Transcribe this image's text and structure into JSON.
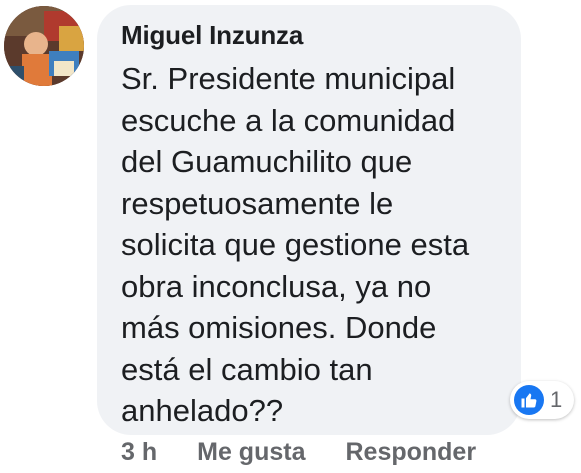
{
  "comment": {
    "author": "Miguel Inzunza",
    "text_lines": [
      "Sr. Presidente municipal",
      "escuche a la comunidad",
      "del Guamuchilito que",
      "respetuosamente le",
      "solicita que gestione esta",
      "obra inconclusa, ya no",
      "más omisiones. Donde",
      "está el cambio tan",
      "anhelado??"
    ],
    "reactions": {
      "icon": "thumbs-up-icon",
      "count": "1",
      "color": "#1877f2"
    },
    "actions": {
      "timestamp": "3 h",
      "like_label": "Me gusta",
      "reply_label": "Responder"
    }
  },
  "colors": {
    "bubble_background": "#f0f2f5",
    "text": "#1c1e21",
    "secondary_text": "#65676b"
  }
}
